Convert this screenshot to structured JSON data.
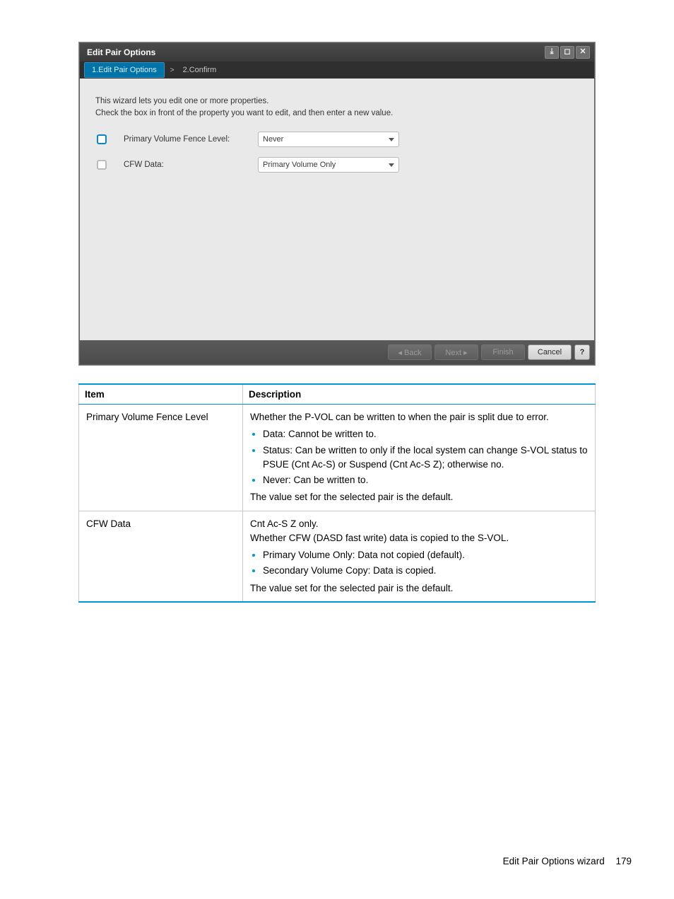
{
  "dialog": {
    "title": "Edit Pair Options",
    "steps": {
      "active": "1.Edit Pair Options",
      "sep": ">",
      "inactive": "2.Confirm"
    },
    "intro_line1": "This wizard lets you edit one or more properties.",
    "intro_line2": "Check the box in front of the property you want to edit, and then enter a new value.",
    "rows": {
      "fence": {
        "label": "Primary Volume Fence Level:",
        "value": "Never"
      },
      "cfw": {
        "label": "CFW Data:",
        "value": "Primary Volume Only"
      }
    },
    "buttons": {
      "back": "◂ Back",
      "next": "Next ▸",
      "finish": "Finish",
      "cancel": "Cancel",
      "help": "?"
    }
  },
  "table": {
    "headers": {
      "item": "Item",
      "desc": "Description"
    },
    "row1": {
      "item": "Primary Volume Fence Level",
      "intro": "Whether the P-VOL can be written to when the pair is split due to error.",
      "b1": "Data: Cannot be written to.",
      "b2": "Status: Can be written to only if the local system can change S-VOL status to PSUE (Cnt Ac-S) or Suspend (Cnt Ac-S Z); otherwise no.",
      "b3": "Never: Can be written to.",
      "outro": "The value set for the selected pair is the default."
    },
    "row2": {
      "item": "CFW Data",
      "intro1": "Cnt Ac-S Z only.",
      "intro2": "Whether CFW (DASD fast write) data is copied to the S-VOL.",
      "b1": "Primary Volume Only: Data not copied (default).",
      "b2": "Secondary Volume Copy: Data is copied.",
      "outro": "The value set for the selected pair is the default."
    }
  },
  "footer": {
    "text": "Edit Pair Options wizard",
    "page": "179"
  }
}
